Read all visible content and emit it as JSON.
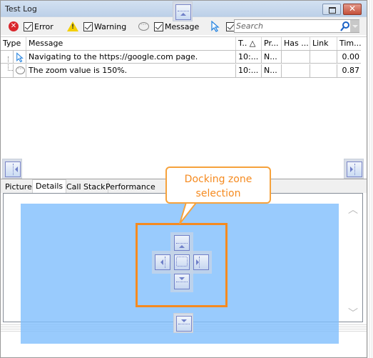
{
  "window": {
    "title": "Test Log",
    "restore_label": "restore",
    "close_label": "✕"
  },
  "toolbar": {
    "filters": [
      {
        "icon": "error-icon",
        "label": "Error",
        "checked": true
      },
      {
        "icon": "warning-icon",
        "label": "Warning",
        "checked": true
      },
      {
        "icon": "message-icon",
        "label": "Message",
        "checked": true
      },
      {
        "icon": "event-cursor-icon",
        "label": "",
        "checked": true
      }
    ],
    "search": {
      "placeholder": "Search",
      "value": ""
    }
  },
  "grid": {
    "columns": [
      "Type",
      "Message",
      "T.. △",
      "Pr...",
      "Has ...",
      "Link",
      "Tim..."
    ],
    "rows": [
      {
        "type_icon": "event-cursor-icon",
        "message": "Navigating to the https://google.com page.",
        "time": "10:...",
        "priority": "N...",
        "has": "",
        "link": "",
        "time_elapsed": "0.00"
      },
      {
        "type_icon": "message-icon",
        "message": "The zoom value is 150%.",
        "time": "10:...",
        "priority": "N...",
        "has": "",
        "link": "",
        "time_elapsed": "0.87"
      }
    ]
  },
  "bottom_tabs": {
    "items": [
      "Picture",
      "Details",
      "Call Stack",
      "Performance Cou"
    ],
    "active": "Details"
  },
  "callout": {
    "text_line1": "Docking zone",
    "text_line2": "selection",
    "color": "#f58a1f"
  },
  "colors": {
    "dock_preview": "#80befc",
    "highlight_border": "#f58a1f"
  }
}
